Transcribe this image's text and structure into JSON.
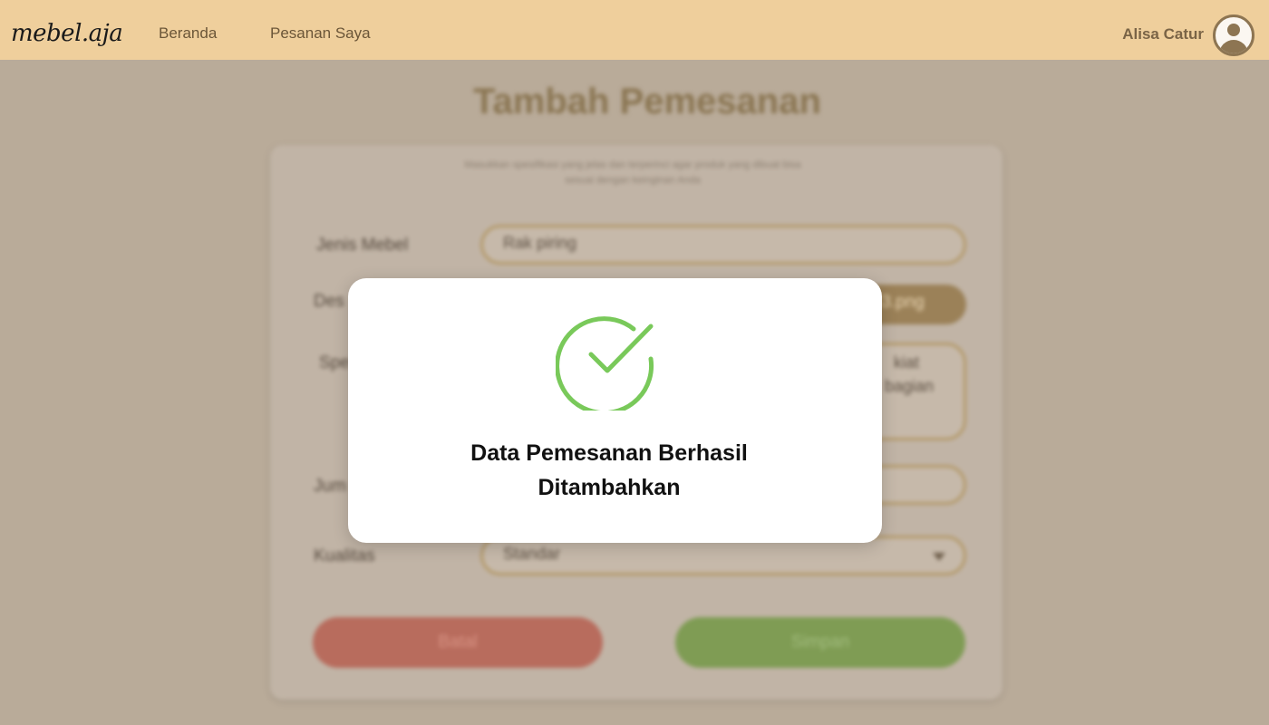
{
  "navbar": {
    "logo": "mebel.aja",
    "links": [
      {
        "label": "Beranda"
      },
      {
        "label": "Pesanan Saya"
      }
    ],
    "user_name": "Alisa Catur",
    "avatar_icon": "user-circle-icon"
  },
  "page": {
    "title": "Tambah Pemesanan",
    "hint_line1": "Masukkan spesifikasi yang jelas dan terperinci agar produk yang dibuat bisa",
    "hint_line2": "sesuai dengan keinginan Anda",
    "form": {
      "jenis_label": "Jenis Mebel",
      "jenis_value": "Rak piring",
      "desain_label": "Des",
      "desain_file": "-3.png",
      "spek_label": "Spe",
      "spek_fragment1": "kiat",
      "spek_fragment2": "bagian",
      "jumlah_label": "Jum",
      "kualitas_label": "Kualitas",
      "kualitas_value": "Standar",
      "batal_label": "Batal",
      "simpan_label": "Simpan"
    }
  },
  "modal": {
    "icon": "check-circle-icon",
    "message_line1": "Data Pemesanan Berhasil",
    "message_line2": "Ditambahkan"
  },
  "colors": {
    "navbar": "#efcf9c",
    "overlay": "#b9ab99",
    "success": "#79c95a",
    "batal": "#b86c5d",
    "simpan": "#7f9c54"
  }
}
